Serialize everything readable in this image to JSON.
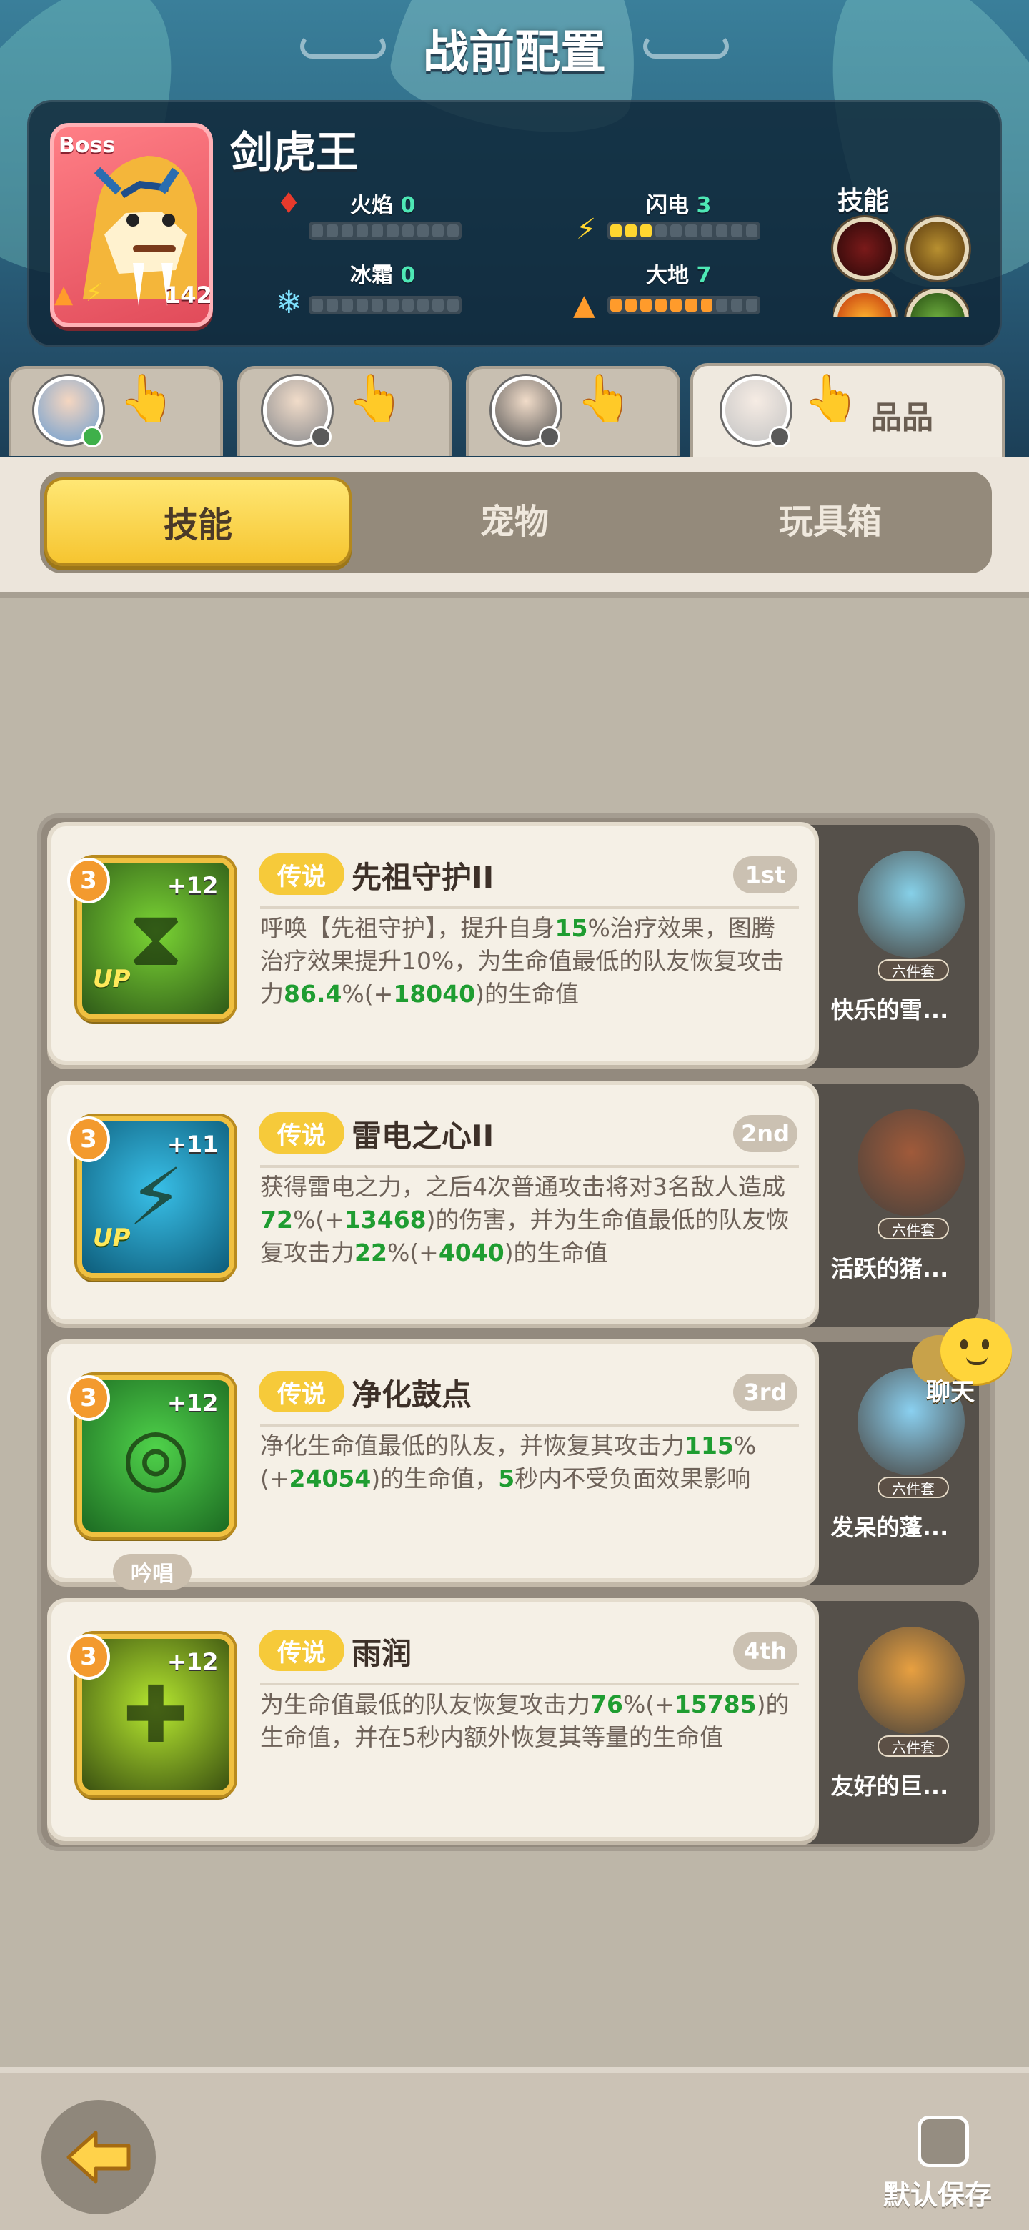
{
  "header": {
    "title": "战前配置",
    "boss": {
      "tag": "Boss",
      "level": "142",
      "name": "剑虎王"
    },
    "elements": [
      {
        "label": "火焰",
        "value": "0",
        "filled": 0,
        "color": "#e83a2c",
        "icon": "flame-icon"
      },
      {
        "label": "闪电",
        "value": "3",
        "filled": 3,
        "color": "#ffd630",
        "icon": "lightning-icon"
      },
      {
        "label": "冰霜",
        "value": "0",
        "filled": 0,
        "color": "#7fe2ff",
        "icon": "snowflake-icon"
      },
      {
        "label": "大地",
        "value": "7",
        "filled": 7,
        "color": "#ff9b2b",
        "icon": "earth-icon"
      }
    ],
    "skills_label": "技能"
  },
  "team_tabs": [
    {
      "avatar": "hero-blue-hair",
      "selected": false
    },
    {
      "avatar": "hero-grey-hair",
      "selected": false
    },
    {
      "avatar": "hero-dark-hair",
      "selected": false
    },
    {
      "avatar": "hero-white-hair",
      "selected": true,
      "extra": "品品"
    }
  ],
  "tabs": {
    "skill": "技能",
    "pet": "宠物",
    "toybox": "玩具箱"
  },
  "skills": [
    {
      "level": "3",
      "plus": "+12",
      "up": "UP",
      "rarity": "传说",
      "name": "先祖守护II",
      "rank": "1st",
      "desc": [
        "呼唤【先祖守护】，提升自身",
        {
          "g": "15"
        },
        "%治疗效果，图腾治疗效果提升10%，为生命值最低的队友恢复攻击力",
        {
          "g": "86.4"
        },
        "%(+",
        {
          "g": "18040"
        },
        ")的生命值"
      ],
      "pet": {
        "tag": "六件套",
        "name": "快乐的雪..."
      },
      "colors": [
        "#2f5a18",
        "#7ad434"
      ]
    },
    {
      "level": "3",
      "plus": "+11",
      "up": "UP",
      "rarity": "传说",
      "name": "雷电之心II",
      "rank": "2nd",
      "desc": [
        "获得雷电之力，之后4次普通攻击将对3名敌人造成",
        {
          "g": "72"
        },
        "%(+",
        {
          "g": "13468"
        },
        ")的伤害，并为生命值最低的队友恢复攻击力",
        {
          "g": "22"
        },
        "%(+",
        {
          "g": "4040"
        },
        ")的生命值"
      ],
      "pet": {
        "tag": "六件套",
        "name": "活跃的猪..."
      },
      "colors": [
        "#0d5c7a",
        "#39c0e8"
      ]
    },
    {
      "level": "3",
      "plus": "+12",
      "up": "",
      "rarity": "传说",
      "name": "净化鼓点",
      "rank": "3rd",
      "chant": "吟唱",
      "desc": [
        "净化生命值最低的队友，并恢复其攻击力",
        {
          "g": "115"
        },
        "%(+",
        {
          "g": "24054"
        },
        ")的生命值，",
        {
          "g": "5"
        },
        "秒内不受负面效果影响"
      ],
      "pet": {
        "tag": "六件套",
        "name": "发呆的蓬..."
      },
      "colors": [
        "#1c6a22",
        "#4fd24a"
      ]
    },
    {
      "level": "3",
      "plus": "+12",
      "up": "",
      "rarity": "传说",
      "name": "雨润",
      "rank": "4th",
      "desc": [
        "为生命值最低的队友恢复攻击力",
        {
          "g": "76"
        },
        "%(+",
        {
          "g": "15785"
        },
        ")的生命值，并在5秒内额外恢复其等量的生命值"
      ],
      "pet": {
        "tag": "六件套",
        "name": "友好的巨..."
      },
      "colors": [
        "#3a5010",
        "#b6e830"
      ]
    }
  ],
  "chat_label": "聊天",
  "footer": {
    "save_label": "默认保存"
  }
}
